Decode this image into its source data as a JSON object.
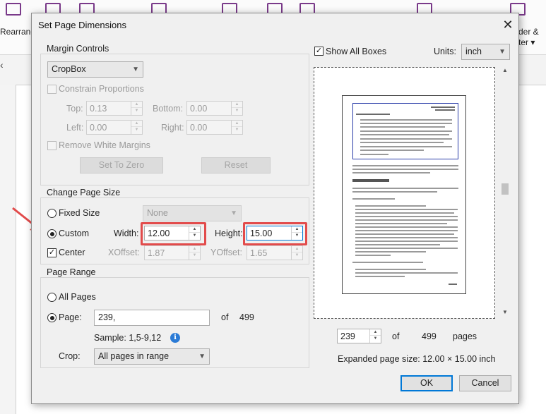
{
  "background_app": {
    "left_label": "Rearrange",
    "right_label_line1": "der &",
    "right_label_line2": "ter ▾",
    "left_tab_glyph": "‹"
  },
  "dialog": {
    "title": "Set Page Dimensions",
    "close_glyph": "✕",
    "margin_controls": {
      "title": "Margin Controls",
      "box_select": "CropBox",
      "constrain_proportions": "Constrain Proportions",
      "top_label": "Top:",
      "top_value": "0.13",
      "bottom_label": "Bottom:",
      "bottom_value": "0.00",
      "left_label": "Left:",
      "left_value": "0.00",
      "right_label": "Right:",
      "right_value": "0.00",
      "remove_white_margins": "Remove White Margins",
      "set_to_zero": "Set To Zero",
      "reset": "Reset"
    },
    "change_page_size": {
      "title": "Change Page Size",
      "fixed_size": "Fixed Size",
      "fixed_size_select": "None",
      "custom": "Custom",
      "width_label": "Width:",
      "width_value": "12.00",
      "height_label": "Height:",
      "height_value": "15.00",
      "center": "Center",
      "xoffset_label": "XOffset:",
      "xoffset_value": "1.87",
      "yoffset_label": "YOffset:",
      "yoffset_value": "1.65"
    },
    "page_range": {
      "title": "Page Range",
      "all_pages": "All Pages",
      "page_label": "Page:",
      "page_value": "239,",
      "of_label": "of",
      "total_pages": "499",
      "sample": "Sample: 1,5-9,12",
      "crop_label": "Crop:",
      "crop_select": "All pages in range"
    },
    "preview": {
      "show_all_boxes": "Show All Boxes",
      "units_label": "Units:",
      "units_select": "inch",
      "page_number": "239",
      "of_label": "of",
      "total_pages": "499",
      "pages_label": "pages",
      "expanded_size": "Expanded page size:  12.00 × 15.00  inch"
    },
    "ok": "OK",
    "cancel": "Cancel"
  },
  "colors": {
    "highlight": "#e24b4b",
    "arrow": "#e24b4b",
    "focus": "#0078d7",
    "accent_purple": "#7a3a8a"
  }
}
